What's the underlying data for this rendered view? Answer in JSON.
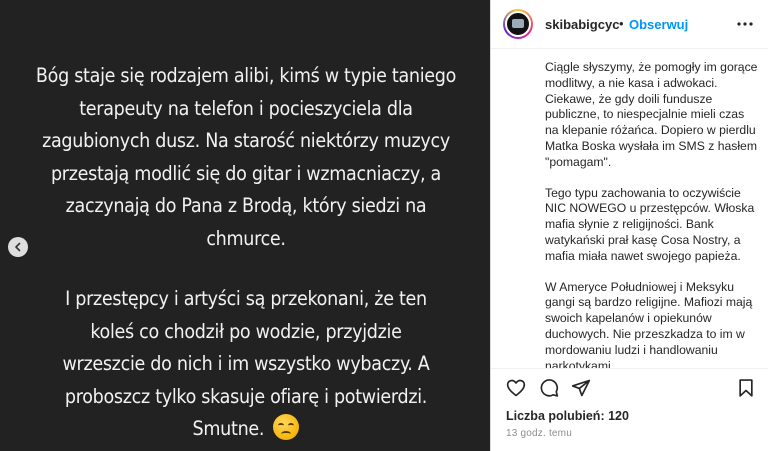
{
  "post_image": {
    "paragraph1": "Bóg staje się rodzajem alibi, kimś w typie taniego terapeuty na telefon i pocieszyciela dla zagubionych dusz. Na starość niektórzy muzycy przestają modlić się do gitar i wzmacniaczy, a zaczynają do Pana z Brodą, który siedzi na chmurce.",
    "paragraph2_lines": [
      "I przestępcy i artyści są przekonani,  że ten",
      "koleś co chodził po wodzie, przyjdzie",
      "wrzeszcie do nich i im wszystko wybaczy. A",
      "proboszcz tylko skasuje ofiarę i potwierdzi.",
      "Smutne."
    ],
    "emoji_icon": "disappointed-face-emoji"
  },
  "header": {
    "username": "skibabigcyc",
    "separator": "•",
    "follow_label": "Obserwuj"
  },
  "caption": {
    "paragraphs": [
      "Ciągle słyszymy, że pomogły im gorące modlitwy, a nie kasa i adwokaci. Ciekawe, że gdy doili fundusze publiczne, to niespecjalnie mieli czas na klepanie różańca. Dopiero w pierdlu Matka Boska wysłała im SMS z hasłem \"pomagam\".",
      "Tego typu zachowania to oczywiście NIC NOWEGO u przestępców. Włoska mafia słynie z religijności. Bank watykański prał kasę Cosa Nostry, a mafia miała nawet swojego papieża.",
      "W Ameryce Południowej i Meksyku gangi są bardzo religijne. Mafiozi mają swoich kapelanów i opiekunów duchowych. Nie przeszkadza to im w mordowaniu ludzi i handlowaniu narkotykami."
    ]
  },
  "footer": {
    "likes": "Liczba polubień: 120",
    "time": "13 godz. temu"
  },
  "colors": {
    "image_bg": "#222222",
    "accent_blue": "#0095f6",
    "text": "#262626",
    "muted": "#8e8e8e"
  }
}
